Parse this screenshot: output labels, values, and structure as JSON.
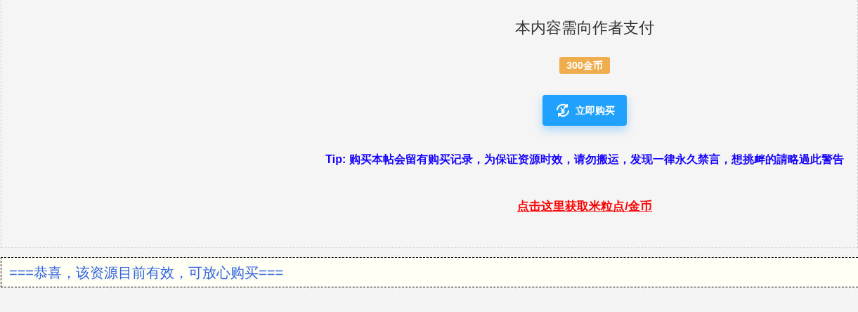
{
  "pay_panel": {
    "title": "本内容需向作者支付",
    "price": "300金币",
    "buy_button": "立即购买",
    "tip": "Tip: 购买本帖会留有购买记录，为保证资源时效，请勿搬运，发现一律永久禁言，想挑衅的請略過此警告",
    "link": "点击这里获取米粒点/金币"
  },
  "notice": "===恭喜，该资源目前有效，可放心购买==="
}
